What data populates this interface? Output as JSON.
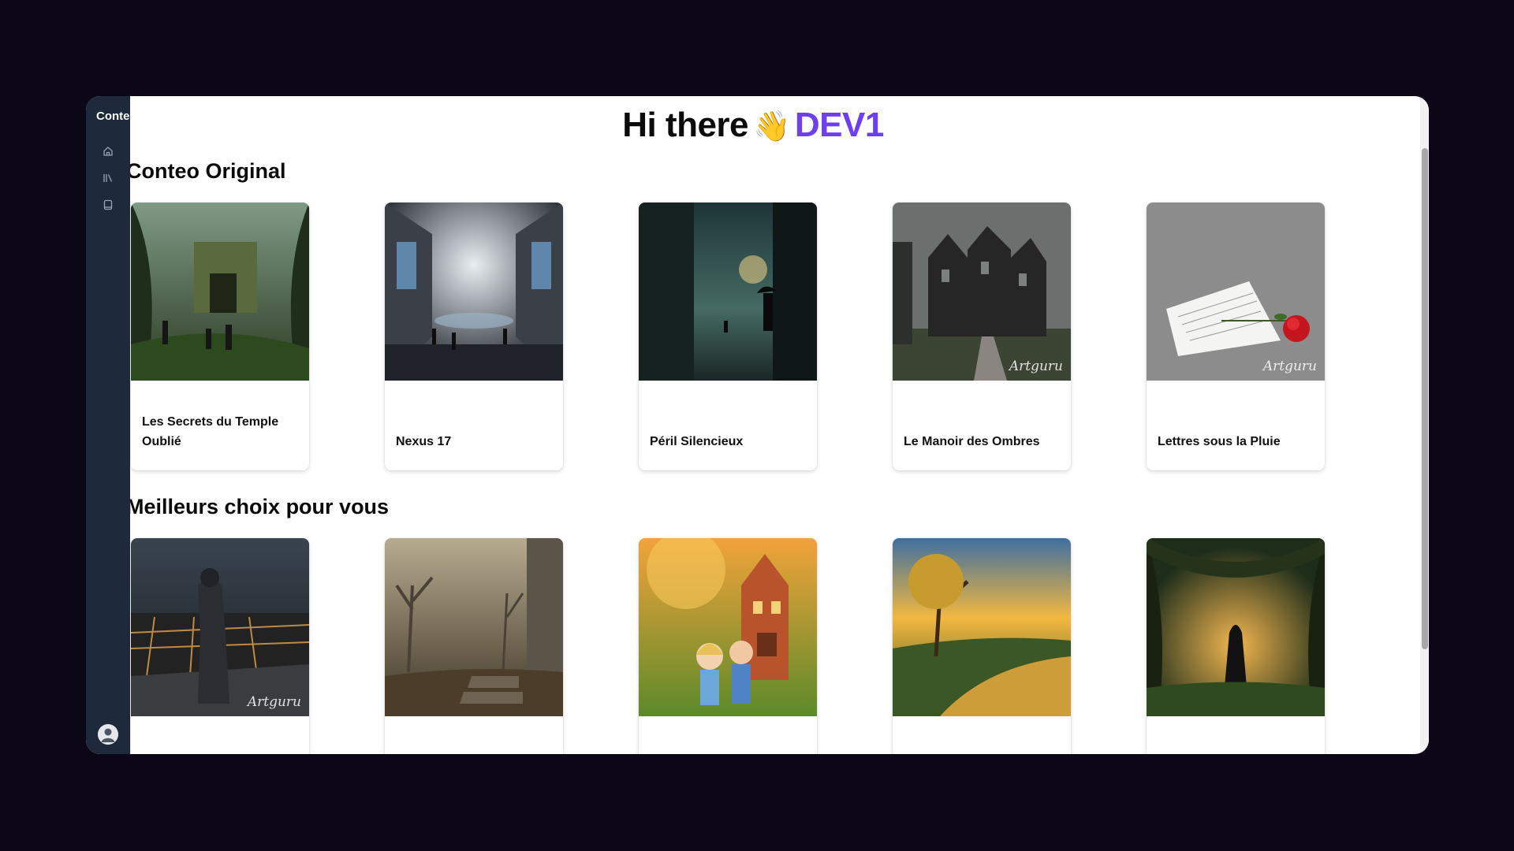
{
  "app": {
    "brand": "Conteo"
  },
  "sidebar": {
    "icons": [
      "home-icon",
      "library-icon",
      "book-icon"
    ]
  },
  "header": {
    "greeting": "Hi there",
    "emoji": "👋",
    "username": "DEV1"
  },
  "colors": {
    "accent": "#6d3ff0",
    "sidebar_bg": "#1e293b",
    "backdrop": "#0c0717"
  },
  "sections": [
    {
      "title": "Conteo Original",
      "cards": [
        {
          "title": "Les Secrets du Temple Oublié",
          "image": "jungle-temple"
        },
        {
          "title": "Nexus 17",
          "image": "sci-fi-hall"
        },
        {
          "title": "Péril Silencieux",
          "image": "rainy-alley"
        },
        {
          "title": "Le Manoir des Ombres",
          "image": "dark-manor",
          "watermark": "Artguru"
        },
        {
          "title": "Lettres sous la Pluie",
          "image": "letter-rose",
          "watermark": "Artguru"
        }
      ]
    },
    {
      "title": "Meilleurs choix pour vous",
      "cards": [
        {
          "title": "",
          "image": "soldier-city",
          "watermark": "Artguru"
        },
        {
          "title": "",
          "image": "misty-ruins"
        },
        {
          "title": "",
          "image": "kids-house"
        },
        {
          "title": "",
          "image": "golden-river"
        },
        {
          "title": "",
          "image": "cloaked-forest"
        }
      ]
    }
  ]
}
